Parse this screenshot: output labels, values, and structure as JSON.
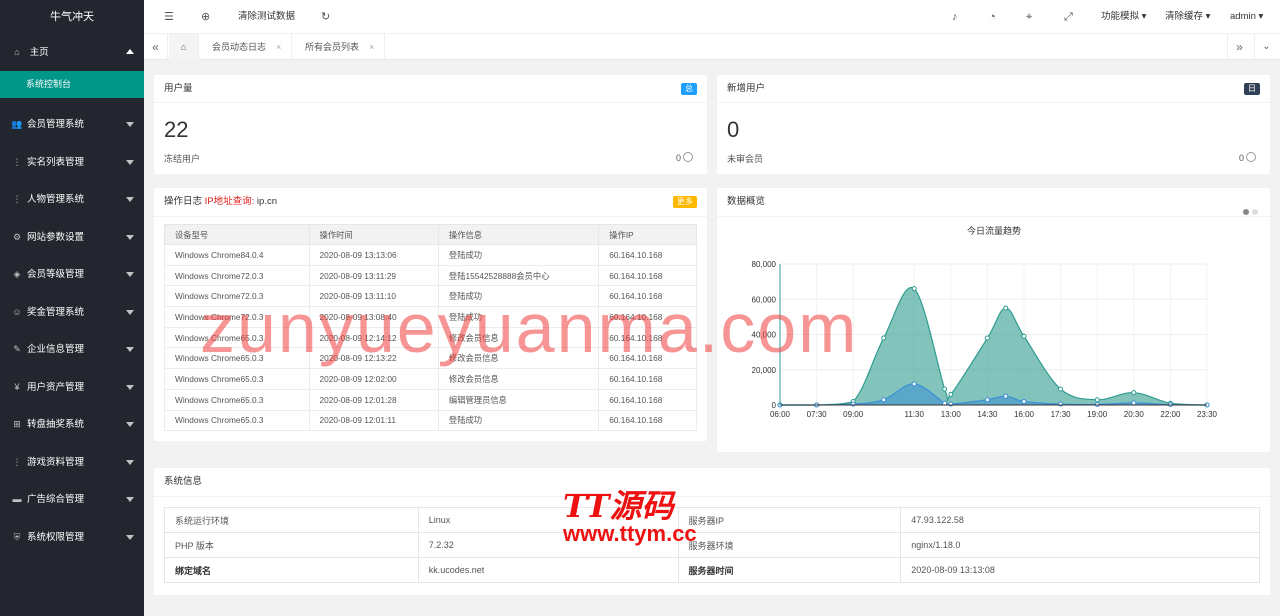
{
  "sidebar": {
    "logo": "牛气冲天",
    "home": {
      "label": "主页",
      "sub": "系统控制台"
    },
    "items": [
      {
        "icon": "users-icon",
        "glyph": "👥",
        "label": "会员管理系统"
      },
      {
        "icon": "dots-vertical-icon",
        "glyph": "⋮",
        "label": "实名列表管理"
      },
      {
        "icon": "dots-vertical-icon",
        "glyph": "⋮",
        "label": "人物管理系统"
      },
      {
        "icon": "gear-icon",
        "glyph": "⚙",
        "label": "网站参数设置"
      },
      {
        "icon": "diamond-icon",
        "glyph": "◈",
        "label": "会员等级管理"
      },
      {
        "icon": "smile-icon",
        "glyph": "☺",
        "label": "奖金管理系统"
      },
      {
        "icon": "edit-icon",
        "glyph": "✎",
        "label": "企业信息管理"
      },
      {
        "icon": "yen-icon",
        "glyph": "¥",
        "label": "用户资产管理"
      },
      {
        "icon": "gift-icon",
        "glyph": "⊞",
        "label": "转盘抽奖系统"
      },
      {
        "icon": "dots-vertical-icon",
        "glyph": "⋮",
        "label": "游戏资料管理"
      },
      {
        "icon": "card-icon",
        "glyph": "▬",
        "label": "广告综合管理"
      },
      {
        "icon": "shield-icon",
        "glyph": "⛨",
        "label": "系统权限管理"
      }
    ]
  },
  "header": {
    "clear_test": "清除测试数据",
    "func_mock": "功能模拟",
    "clear_cache": "清除缓存",
    "user": "admin"
  },
  "tabs": [
    {
      "label": "会员动态日志"
    },
    {
      "label": "所有会员列表"
    }
  ],
  "cards": {
    "users": {
      "title": "用户量",
      "badge": "总",
      "value": "22",
      "sub": "冻结用户",
      "sub_value": "0"
    },
    "new_users": {
      "title": "新增用户",
      "badge": "日",
      "value": "0",
      "sub": "未审会员",
      "sub_value": "0"
    },
    "log": {
      "title": "操作日志",
      "ip_label": "IP地址查询:",
      "ip_site": "ip.cn",
      "more": "更多",
      "columns": [
        "设备型号",
        "操作时间",
        "操作信息",
        "操作IP"
      ],
      "rows": [
        [
          "Windows Chrome84.0.4",
          "2020-08-09 13:13:06",
          "登陆成功",
          "60.164.10.168"
        ],
        [
          "Windows Chrome72.0.3",
          "2020-08-09 13:11:29",
          "登陆15542528888会员中心",
          "60.164.10.168"
        ],
        [
          "Windows Chrome72.0.3",
          "2020-08-09 13:11:10",
          "登陆成功",
          "60.164.10.168"
        ],
        [
          "Windows Chrome72.0.3",
          "2020-08-09 13:08:40",
          "登陆成功",
          "60.164.10.168"
        ],
        [
          "Windows Chrome65.0.3",
          "2020-08-09 12:14:12",
          "修改会员信息",
          "60.164.10.168"
        ],
        [
          "Windows Chrome65.0.3",
          "2020-08-09 12:13:22",
          "修改会员信息",
          "60.164.10.168"
        ],
        [
          "Windows Chrome65.0.3",
          "2020-08-09 12:02:00",
          "修改会员信息",
          "60.164.10.168"
        ],
        [
          "Windows Chrome65.0.3",
          "2020-08-09 12:01:28",
          "编辑管理员信息",
          "60.164.10.168"
        ],
        [
          "Windows Chrome65.0.3",
          "2020-08-09 12:01:11",
          "登陆成功",
          "60.164.10.168"
        ]
      ]
    },
    "overview": {
      "title": "数据概览"
    },
    "sysinfo": {
      "title": "系统信息",
      "rows": [
        [
          "系统运行环境",
          "Linux",
          "服务器IP",
          "47.93.122.58"
        ],
        [
          "PHP 版本",
          "7.2.32",
          "服务器环境",
          "nginx/1.18.0"
        ],
        [
          "绑定域名",
          "kk.ucodes.net",
          "服务器时间",
          "2020-08-09 13:13:08"
        ]
      ]
    }
  },
  "chart_data": {
    "type": "area",
    "title": "今日流量趋势",
    "x": [
      "06:00",
      "07:30",
      "09:00",
      "10:15",
      "11:30",
      "12:45",
      "13:00",
      "14:30",
      "15:15",
      "16:00",
      "17:30",
      "19:00",
      "20:30",
      "22:00",
      "23:30"
    ],
    "xticks": [
      "06:00",
      "07:30",
      "09:00",
      "11:30",
      "13:00",
      "14:30",
      "16:00",
      "17:30",
      "19:00",
      "20:30",
      "22:00",
      "23:30"
    ],
    "ylim": [
      0,
      80000
    ],
    "yticks": [
      "0",
      "20,000",
      "40,000",
      "60,000",
      "80,000"
    ],
    "series": [
      {
        "color": "#2f9c8f",
        "values": [
          0,
          0,
          2000,
          38000,
          66000,
          9000,
          6000,
          38000,
          55000,
          39000,
          9000,
          3000,
          7000,
          1000,
          0
        ]
      },
      {
        "color": "#3a8fd6",
        "values": [
          0,
          0,
          500,
          3000,
          12000,
          1000,
          500,
          3000,
          5000,
          2000,
          500,
          300,
          1200,
          200,
          0
        ]
      }
    ],
    "colors": {
      "line1": "#2f9c8f",
      "line2": "#3a8fd6"
    }
  },
  "watermark": {
    "text1": "zunyueyuanma.com",
    "logo": "TT源码",
    "text2": "www.ttym.cc"
  }
}
